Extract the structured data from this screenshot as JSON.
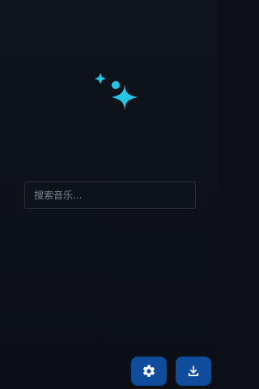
{
  "search": {
    "placeholder": "搜索音乐..."
  },
  "icons": {
    "logo": "sparkle-logo-icon",
    "settings": "gear-icon",
    "download": "download-icon"
  },
  "colors": {
    "background": "#0d1117",
    "accent": "#22c7e5",
    "button": "#0f4c9c",
    "input_border": "#2a313c",
    "placeholder": "#7b8490"
  }
}
